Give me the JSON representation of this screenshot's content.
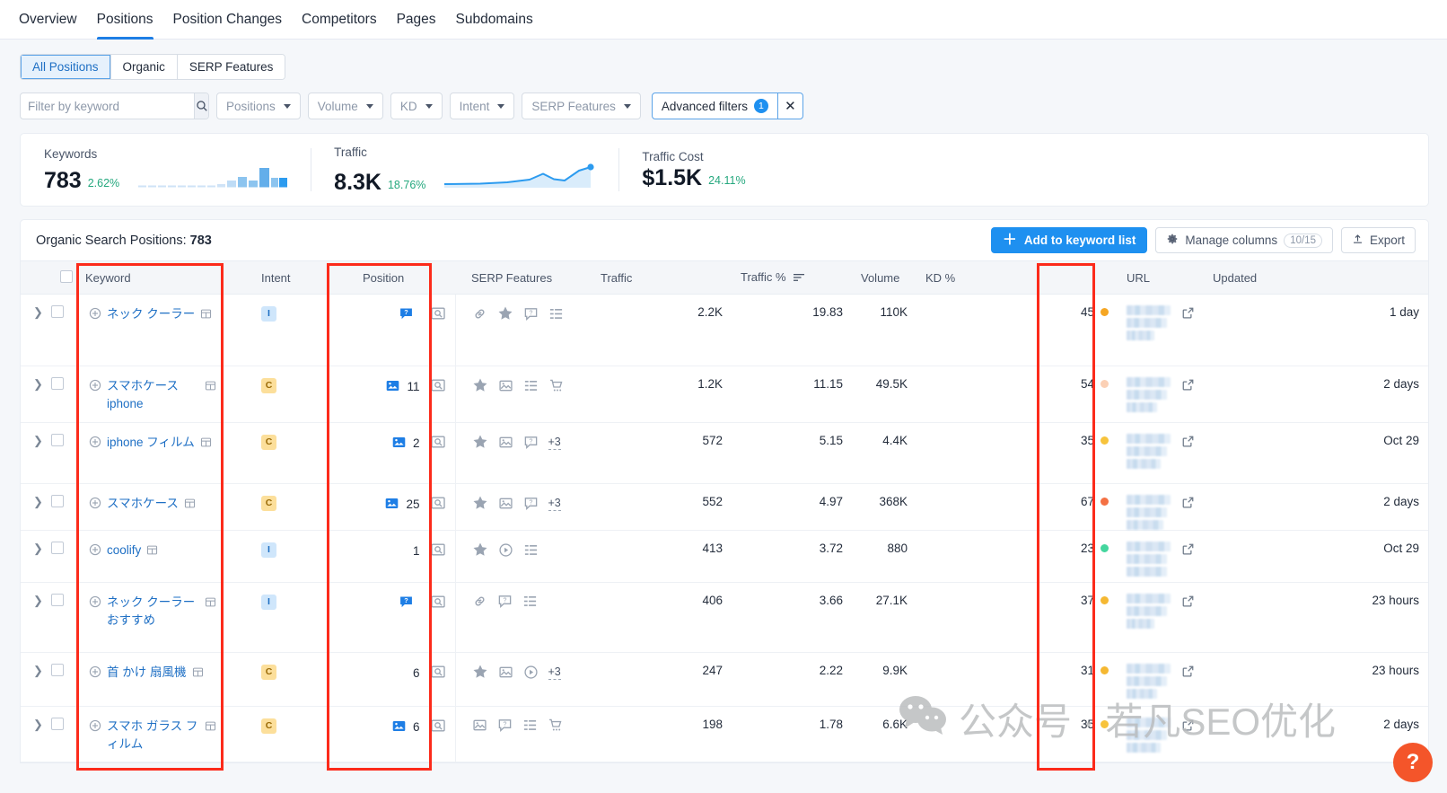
{
  "topnav": {
    "items": [
      {
        "label": "Overview",
        "active": false
      },
      {
        "label": "Positions",
        "active": true
      },
      {
        "label": "Position Changes",
        "active": false
      },
      {
        "label": "Competitors",
        "active": false
      },
      {
        "label": "Pages",
        "active": false
      },
      {
        "label": "Subdomains",
        "active": false
      }
    ]
  },
  "subtabs": {
    "items": [
      {
        "label": "All Positions",
        "active": true
      },
      {
        "label": "Organic",
        "active": false
      },
      {
        "label": "SERP Features",
        "active": false
      }
    ]
  },
  "filters": {
    "search_placeholder": "Filter by keyword",
    "search_value": "",
    "search_icon": "search-icon",
    "dropdowns": [
      {
        "label": "Positions"
      },
      {
        "label": "Volume"
      },
      {
        "label": "KD"
      },
      {
        "label": "Intent"
      },
      {
        "label": "SERP Features"
      }
    ],
    "advanced": {
      "label": "Advanced filters",
      "count": "1",
      "close_icon": "close-icon"
    }
  },
  "metrics": [
    {
      "label": "Keywords",
      "value": "783",
      "delta": "2.62%",
      "spark": "bars"
    },
    {
      "label": "Traffic",
      "value": "8.3K",
      "delta": "18.76%",
      "spark": "line"
    },
    {
      "label": "Traffic Cost",
      "value": "$1.5K",
      "delta": "24.11%",
      "spark": "none"
    }
  ],
  "panel": {
    "title_prefix": "Organic Search Positions: ",
    "title_count": "783",
    "add_to_list_label": "Add to keyword list",
    "add_icon": "plus-icon",
    "manage_columns_label": "Manage columns",
    "manage_columns_count": "10/15",
    "gear_icon": "gear-icon",
    "export_label": "Export",
    "export_icon": "upload-icon"
  },
  "table": {
    "columns": [
      "Keyword",
      "Intent",
      "Position",
      "SERP Features",
      "Traffic",
      "Traffic %",
      "Volume",
      "KD %",
      "URL",
      "Updated"
    ],
    "sorted_column": "Traffic %",
    "sort_icon": "sort-desc-icon",
    "rows": [
      {
        "keyword": "ネック クーラー",
        "intent": "I",
        "position": "",
        "position_icon": "featured-snippet-icon",
        "serp_features": [
          "link-icon",
          "star-icon",
          "faq-icon",
          "list-icon"
        ],
        "serp_more": "",
        "traffic": "2.2K",
        "traffic_pct": "19.83",
        "volume": "110K",
        "kd": "45",
        "kd_color": "#f5a623",
        "updated": "1 day"
      },
      {
        "keyword": "スマホケース iphone",
        "intent": "C",
        "position": "11",
        "position_icon": "image-pack-icon",
        "serp_features": [
          "star-icon",
          "image-icon",
          "list-icon",
          "shopping-icon"
        ],
        "serp_more": "",
        "traffic": "1.2K",
        "traffic_pct": "11.15",
        "volume": "49.5K",
        "kd": "54",
        "kd_color": "#fbd0b5",
        "updated": "2 days"
      },
      {
        "keyword": "iphone フィルム",
        "intent": "C",
        "position": "2",
        "position_icon": "image-pack-icon",
        "serp_features": [
          "star-icon",
          "image-icon",
          "faq-icon"
        ],
        "serp_more": "+3",
        "traffic": "572",
        "traffic_pct": "5.15",
        "volume": "4.4K",
        "kd": "35",
        "kd_color": "#f7c33c",
        "updated": "Oct 29"
      },
      {
        "keyword": "スマホケース",
        "intent": "C",
        "position": "25",
        "position_icon": "image-pack-icon",
        "serp_features": [
          "star-icon",
          "image-icon",
          "faq-icon"
        ],
        "serp_more": "+3",
        "traffic": "552",
        "traffic_pct": "4.97",
        "volume": "368K",
        "kd": "67",
        "kd_color": "#f47043",
        "updated": "2 days"
      },
      {
        "keyword": "coolify",
        "intent": "I",
        "position": "1",
        "position_icon": "",
        "serp_features": [
          "star-icon",
          "video-icon",
          "list-icon"
        ],
        "serp_more": "",
        "traffic": "413",
        "traffic_pct": "3.72",
        "volume": "880",
        "kd": "23",
        "kd_color": "#44d69e",
        "updated": "Oct 29"
      },
      {
        "keyword": "ネック クーラー おすすめ",
        "intent": "I",
        "position": "",
        "position_icon": "featured-snippet-icon",
        "serp_features": [
          "link-icon",
          "faq-icon",
          "list-icon"
        ],
        "serp_more": "",
        "traffic": "406",
        "traffic_pct": "3.66",
        "volume": "27.1K",
        "kd": "37",
        "kd_color": "#f5b832",
        "updated": "23 hours"
      },
      {
        "keyword": "首 かけ 扇風機",
        "intent": "C",
        "position": "6",
        "position_icon": "",
        "serp_features": [
          "star-icon",
          "image-icon",
          "video-icon"
        ],
        "serp_more": "+3",
        "traffic": "247",
        "traffic_pct": "2.22",
        "volume": "9.9K",
        "kd": "31",
        "kd_color": "#f5b832",
        "updated": "23 hours"
      },
      {
        "keyword": "スマホ ガラス フィルム",
        "intent": "C",
        "position": "6",
        "position_icon": "image-pack-icon",
        "serp_features": [
          "image-icon",
          "faq-icon",
          "list-icon",
          "shopping-icon"
        ],
        "serp_more": "",
        "traffic": "198",
        "traffic_pct": "1.78",
        "volume": "6.6K",
        "kd": "35",
        "kd_color": "#f7c33c",
        "updated": "2 days"
      }
    ]
  },
  "watermark": {
    "text": "公众号 · 若凡SEO优化",
    "icon": "wechat-icon"
  },
  "help": {
    "label": "?"
  },
  "accent_colors": {
    "primary_blue": "#1e90f0",
    "link_blue": "#1e6fc4",
    "annotation_red": "#fc2b1b",
    "positive_green": "#25a87e"
  }
}
